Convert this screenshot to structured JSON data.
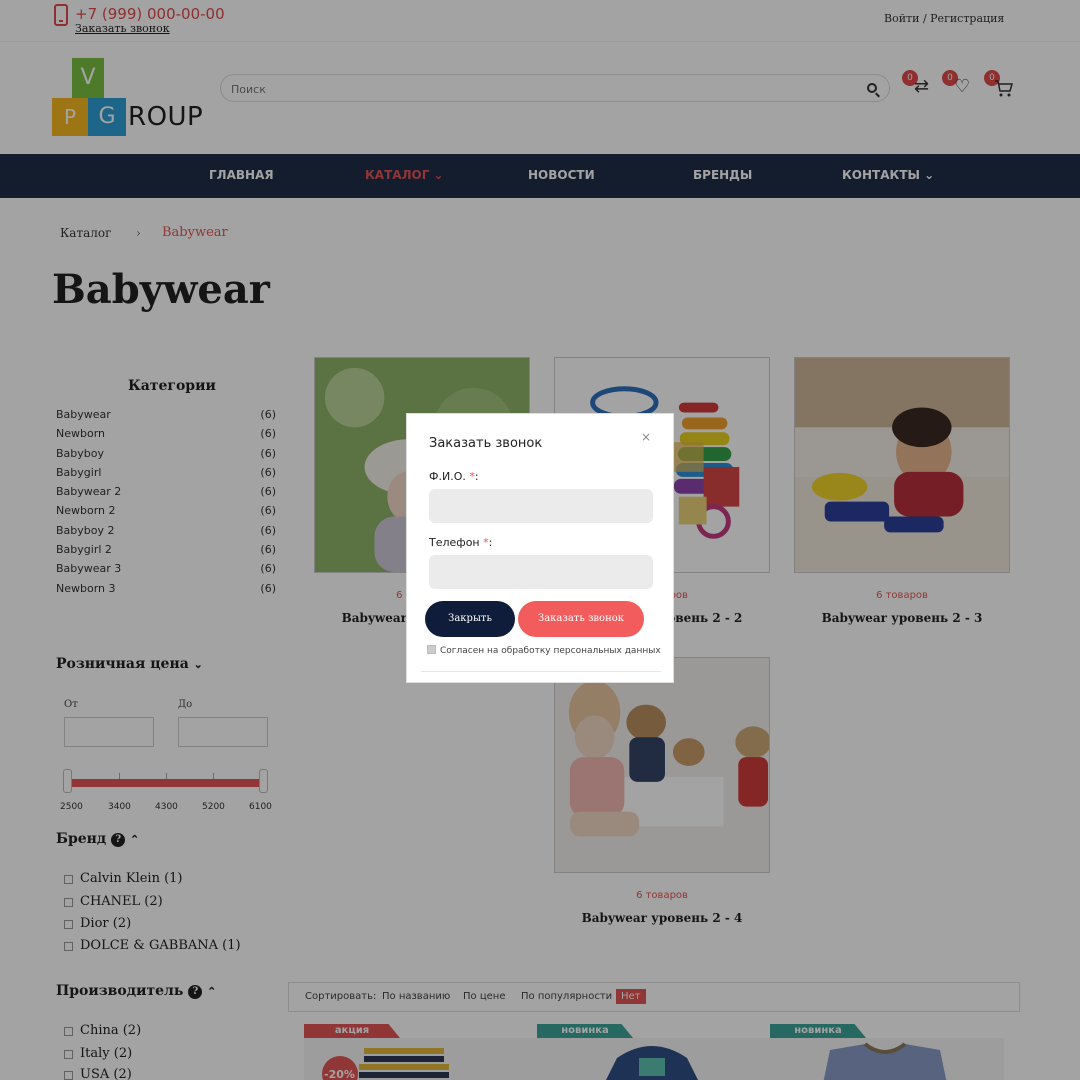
{
  "topbar": {
    "phone": "+7 (999) 000-00-00",
    "callback_link": "Заказать звонок",
    "login": "Войти / Регистрация"
  },
  "logo": {
    "v": "V",
    "p": "P",
    "g": "G",
    "rest": "ROUP"
  },
  "search": {
    "placeholder": "Поиск"
  },
  "header_icons": [
    {
      "name": "compare-icon",
      "count": "0"
    },
    {
      "name": "wishlist-icon",
      "count": "0"
    },
    {
      "name": "cart-icon",
      "count": "0"
    }
  ],
  "nav": {
    "items": [
      "ГЛАВНАЯ",
      "КАТАЛОГ ⌄",
      "НОВОСТИ",
      "БРЕНДЫ",
      "КОНТАКТЫ ⌄"
    ]
  },
  "breadcrumb": {
    "root": "Каталог",
    "sep": "›",
    "current": "Babywear"
  },
  "page_title": "Babywear",
  "categories": {
    "title": "Категории",
    "items": [
      {
        "name": "Babywear",
        "count": "(6)"
      },
      {
        "name": "Newborn",
        "count": "(6)"
      },
      {
        "name": "Babyboy",
        "count": "(6)"
      },
      {
        "name": "Babygirl",
        "count": "(6)"
      },
      {
        "name": "Babywear 2",
        "count": "(6)"
      },
      {
        "name": "Newborn 2",
        "count": "(6)"
      },
      {
        "name": "Babyboy 2",
        "count": "(6)"
      },
      {
        "name": "Babygirl 2",
        "count": "(6)"
      },
      {
        "name": "Babywear 3",
        "count": "(6)"
      },
      {
        "name": "Newborn 3",
        "count": "(6)"
      }
    ]
  },
  "price_filter": {
    "title": "Розничная цена",
    "from_label": "От",
    "to_label": "До",
    "ticks": [
      "2500",
      "3400",
      "4300",
      "5200",
      "6100"
    ]
  },
  "brand_filter": {
    "title": "Бренд",
    "items": [
      "Calvin Klein  (1)",
      "CHANEL  (2)",
      "Dior  (2)",
      "DOLCE & GABBANA  (1)"
    ]
  },
  "maker_filter": {
    "title": "Производитель",
    "items": [
      "China  (2)",
      "Italy  (2)",
      "USA  (2)"
    ]
  },
  "subcategories": [
    {
      "count": "6 товаров",
      "name": "Babywear уровень 2 - 1"
    },
    {
      "count": "6 товаров",
      "name": "Babywear уровень 2 - 2"
    },
    {
      "count": "6 товаров",
      "name": "Babywear уровень 2 - 3"
    },
    {
      "count": "6 товаров",
      "name": "Babywear уровень 2 - 4"
    }
  ],
  "sort": {
    "label": "Сортировать:",
    "options": [
      "По названию",
      "По цене",
      "По популярности"
    ],
    "active": "Нет"
  },
  "products": [
    {
      "ribbon": "акция",
      "ribbon_color": "#e35555",
      "discount": "-20%"
    },
    {
      "ribbon": "новинка",
      "ribbon_color": "#3aa59a"
    },
    {
      "ribbon": "новинка",
      "ribbon_color": "#3aa59a"
    }
  ],
  "modal": {
    "title": "Заказать звонок",
    "close": "×",
    "name_label": "Ф.И.О.",
    "phone_label": "Телефон",
    "required": "*",
    "colon": ":",
    "close_button": "Закрыть",
    "order_button": "Заказать звонок",
    "consent": "Согласен на обработку персональных данных"
  }
}
